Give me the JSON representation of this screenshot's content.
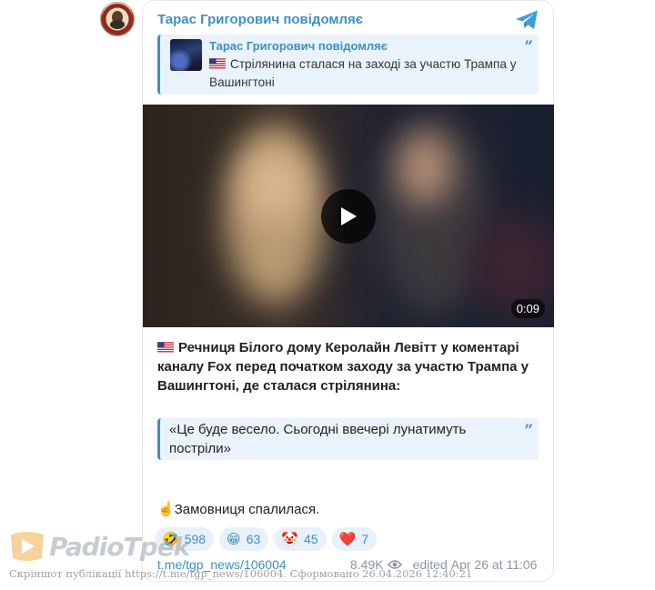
{
  "channel": {
    "title": "Тарас Григорович повідомляє"
  },
  "forward": {
    "author": "Тарас Григорович повідомляє",
    "text": "Стрілянина сталася на заході за участю Трампа у Вашингтоні"
  },
  "video": {
    "duration": "0:09"
  },
  "post": {
    "text": "Речниця Білого дому Керолайн Левітт у коментарі каналу Fox перед початком заходу за участю Трампа у Вашингтоні, де сталася стрілянина:",
    "quote": "«Це буде весело. Сьогодні ввечері лунатимуть постріли»",
    "footnote_emoji": "☝️",
    "footnote": "Замовниця спалилася."
  },
  "reactions": [
    {
      "emoji": "🤣",
      "count": "598"
    },
    {
      "emoji": "😁",
      "count": "63"
    },
    {
      "emoji": "🤡",
      "count": "45"
    },
    {
      "emoji": "❤️",
      "count": "7"
    }
  ],
  "footer": {
    "link": "t.me/tgp_news/106004",
    "views": "8.49K",
    "edited": "edited",
    "date": "Apr 26 at 11:06"
  },
  "watermark": {
    "brand": "PadioTpek",
    "caption": "Скріншот публікації https://t.me/tgp_news/106004. Сформовано 26.04.2026 12:40:21"
  },
  "colors": {
    "accent": "#3d8fc4",
    "quote_bg": "#eaf3fb",
    "muted": "#8a96a3"
  }
}
